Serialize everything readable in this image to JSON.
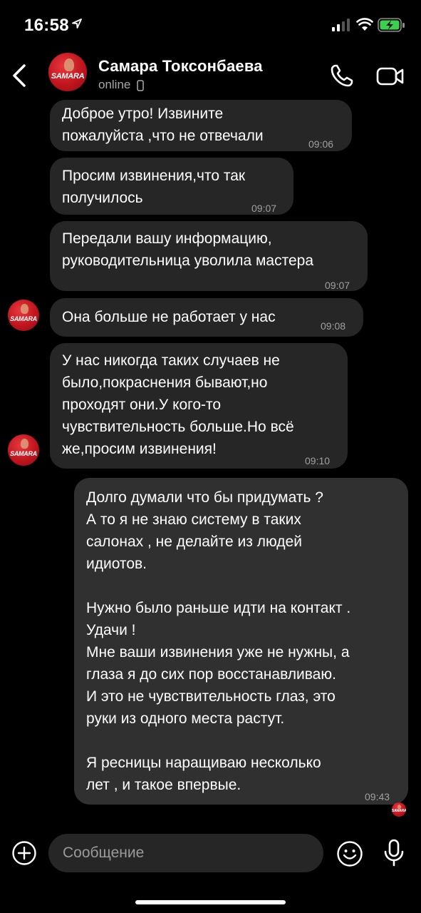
{
  "status_bar": {
    "time": "16:58"
  },
  "header": {
    "contact_name": "Самара Токсонбаева",
    "contact_status": "online",
    "avatar_text": "SAMARA"
  },
  "messages": [
    {
      "text": "Доброе утро! Извините\nпожалуйста ,что не отвечали",
      "time": "09:06"
    },
    {
      "text": "Просим извинения,что так\nполучилось",
      "time": "09:07"
    },
    {
      "text": "Передали вашу информацию,\nруководительница уволила мастера",
      "time": "09:07"
    },
    {
      "text": "Она больше не работает у нас",
      "time": "09:08"
    },
    {
      "text": "У нас никогда таких случаев не\nбыло,покраснения бывают,но\nпроходят они.У кого-то\nчувствительность больше.Но всё\nже,просим извинения!",
      "time": "09:10"
    },
    {
      "text": "Долго думали что бы придумать ?\nА то я не знаю систему в таких\nсалонах , не делайте из людей\nидиотов.\n\nНужно было раньше идти на контакт .\nУдачи !\nМне ваши извинения уже не нужны, а\nглаза я до сих пор восстанавливаю.\nИ это не чувствительность глаз, это\nруки из одного места растут.\n\nЯ ресницы наращиваю несколько\nлет , и такое впервые.",
      "time": "09:43"
    }
  ],
  "composer": {
    "placeholder": "Сообщение"
  },
  "icons": {
    "back": "chevron-left-icon",
    "call": "phone-icon",
    "video": "video-camera-icon",
    "add": "plus-circle-icon",
    "emoji": "smiley-icon",
    "mic": "microphone-icon"
  },
  "colors": {
    "background": "#000000",
    "bubble_incoming": "#262626",
    "bubble_outgoing": "#303030",
    "timestamp": "#a0a0a0",
    "avatar_red": "#c0151e"
  }
}
